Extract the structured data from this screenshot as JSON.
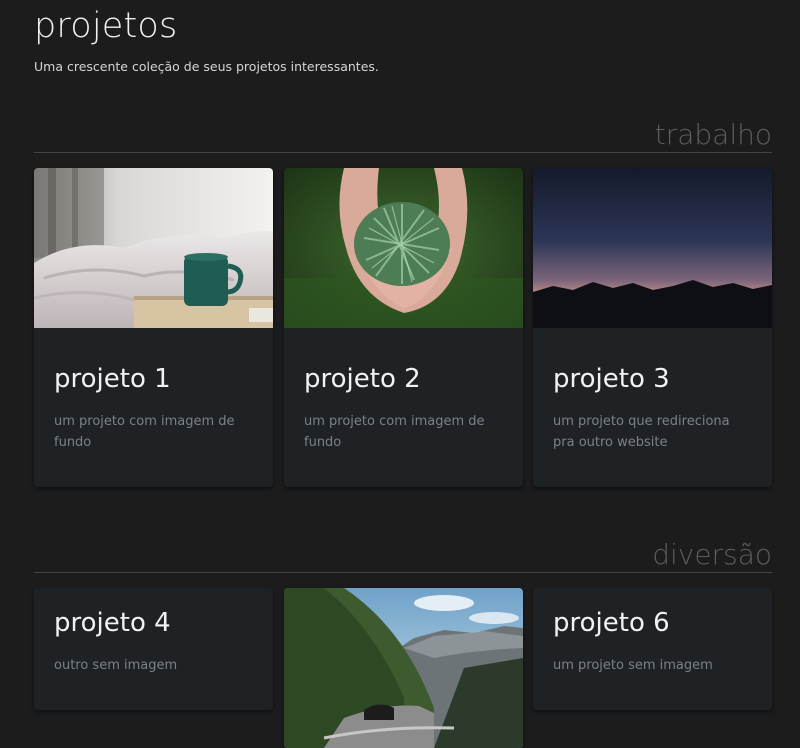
{
  "header": {
    "title": "projetos",
    "subtitle": "Uma crescente coleção de seus projetos interessantes."
  },
  "sections": [
    {
      "title": "trabalho",
      "cards": [
        {
          "title": "projeto 1",
          "description": "um projeto com imagem de fundo",
          "image": "coffee-mug-bed"
        },
        {
          "title": "projeto 2",
          "description": "um projeto com imagem de fundo",
          "image": "hands-holding-pine-needles"
        },
        {
          "title": "projeto 3",
          "description": "um projeto que redireciona pra outro website",
          "image": "mountain-sunset"
        }
      ]
    },
    {
      "title": "diversão",
      "cards": [
        {
          "title": "projeto 4",
          "description": "outro sem imagem"
        },
        {
          "image": "mountain-road-tunnel"
        },
        {
          "title": "projeto 6",
          "description": "um projeto sem imagem"
        }
      ]
    }
  ]
}
